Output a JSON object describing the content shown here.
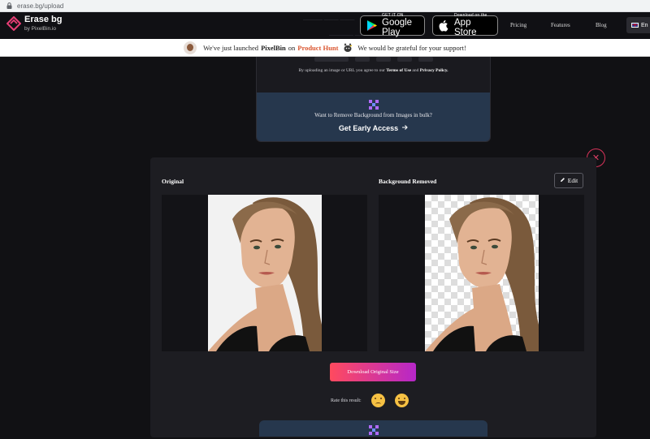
{
  "browser": {
    "url": "erase.bg/upload"
  },
  "header": {
    "brand_name": "Erase bg",
    "brand_sub": "by PixelBin.io",
    "google_play_small": "GET IT ON",
    "google_play_big": "Google Play",
    "app_store_small": "Download on the",
    "app_store_big": "App Store",
    "nav": [
      "Pricing",
      "Features",
      "Blog"
    ],
    "lang": "En"
  },
  "announcement": {
    "pre": "We've just launched",
    "brand": "PixelBin",
    "on": "on",
    "product_hunt": "Product Hunt",
    "post": "We would be grateful for your support!"
  },
  "upload_card": {
    "terms_pre": "By uploading an image or URL you agree to our",
    "terms_link": "Terms of Use",
    "terms_and": "and",
    "privacy_link": "Privacy Policy.",
    "bulk_text": "Want to Remove Background from Images in bulk?",
    "bulk_cta": "Get Early Access"
  },
  "results": {
    "label_original": "Original",
    "label_removed": "Background Removed",
    "edit_label": "Edit",
    "download_label": "Download Original Size",
    "rate_label": "Rate this result:"
  },
  "colors": {
    "accent_gradient_start": "#ff4a5e",
    "accent_gradient_end": "#b627c9",
    "close_red": "#e14067",
    "bulk_bg": "#26374d",
    "product_hunt": "#da552f"
  }
}
